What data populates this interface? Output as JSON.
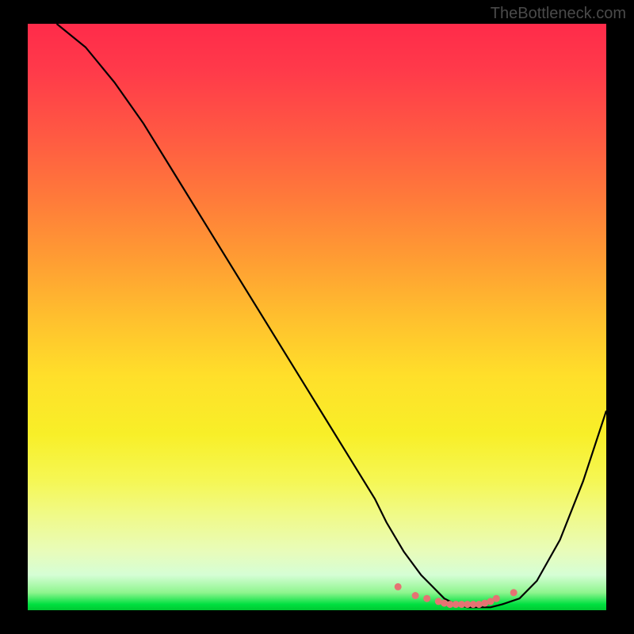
{
  "watermark": "TheBottleneck.com",
  "chart_data": {
    "type": "line",
    "title": "",
    "xlabel": "",
    "ylabel": "",
    "xlim": [
      0,
      100
    ],
    "ylim": [
      0,
      100
    ],
    "series": [
      {
        "name": "bottleneck-curve",
        "x": [
          5,
          10,
          15,
          20,
          25,
          30,
          35,
          40,
          45,
          50,
          55,
          60,
          62,
          65,
          68,
          70,
          72,
          74,
          76,
          78,
          80,
          82,
          85,
          88,
          92,
          96,
          100
        ],
        "y": [
          100,
          96,
          90,
          83,
          75,
          67,
          59,
          51,
          43,
          35,
          27,
          19,
          15,
          10,
          6,
          4,
          2,
          1,
          0.5,
          0.5,
          0.5,
          1,
          2,
          5,
          12,
          22,
          34
        ]
      }
    ],
    "markers": {
      "name": "optimal-range-points",
      "color": "#e57373",
      "x": [
        64,
        67,
        69,
        71,
        72,
        73,
        74,
        75,
        76,
        77,
        78,
        79,
        80,
        81,
        84
      ],
      "y": [
        4,
        2.5,
        2,
        1.5,
        1.2,
        1,
        1,
        1,
        1,
        1,
        1,
        1.2,
        1.5,
        2,
        3
      ]
    },
    "gradient": {
      "description": "vertical-heat-gradient",
      "stops": [
        {
          "pos": 0,
          "color": "#ff2b4a"
        },
        {
          "pos": 50,
          "color": "#ffbf2e"
        },
        {
          "pos": 78,
          "color": "#f5f755"
        },
        {
          "pos": 97,
          "color": "#8ef58e"
        },
        {
          "pos": 100,
          "color": "#00c832"
        }
      ]
    }
  }
}
